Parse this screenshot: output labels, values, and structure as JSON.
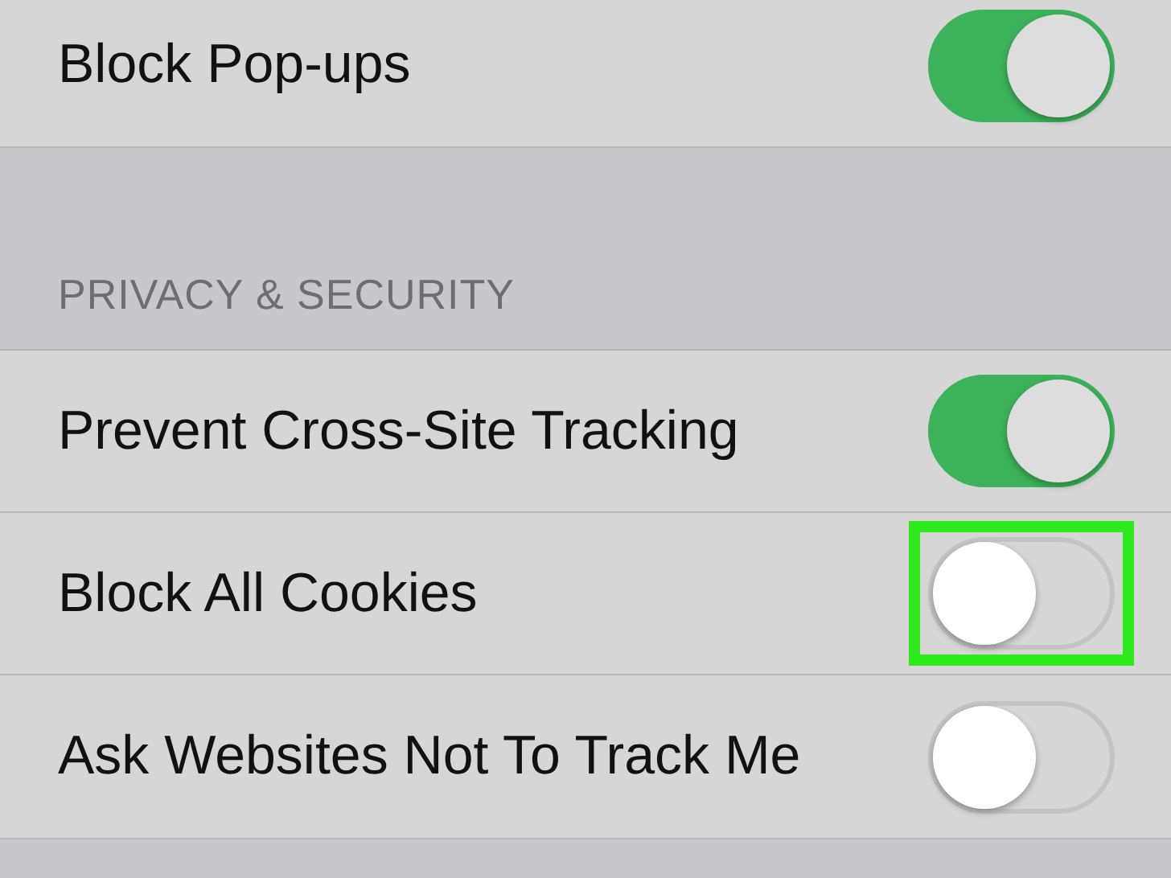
{
  "sections": [
    {
      "rows": [
        {
          "label": "Block Pop-ups",
          "on": true
        }
      ]
    },
    {
      "header": "PRIVACY & SECURITY",
      "rows": [
        {
          "label": "Prevent Cross-Site Tracking",
          "on": true
        },
        {
          "label": "Block All Cookies",
          "on": false,
          "highlighted": true
        },
        {
          "label": "Ask Websites Not To Track Me",
          "on": false
        }
      ]
    }
  ]
}
